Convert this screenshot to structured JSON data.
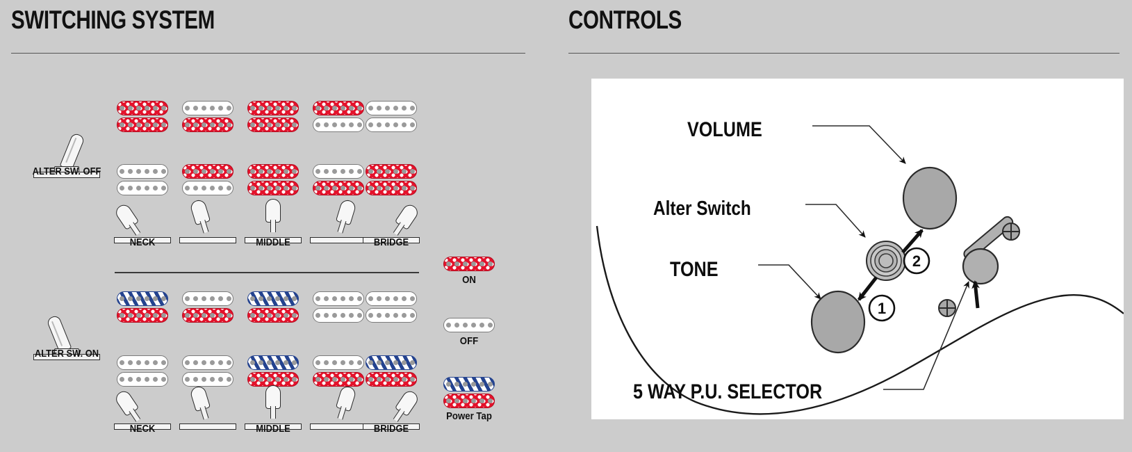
{
  "page": {
    "background_color": "#cccccc",
    "accent_on_color": "#e4122b",
    "accent_tap_color": "#24438f",
    "knob_color": "#a8a8a8"
  },
  "switching": {
    "title": "SWITCHING SYSTEM",
    "groups": [
      {
        "switch_label": "ALTER SW. OFF",
        "switch_state": "off",
        "position_labels": [
          "NECK",
          "",
          "MIDDLE",
          "",
          "BRIDGE"
        ],
        "rows": [
          [
            "on_on",
            "off_on",
            "on_on",
            "on_off",
            "off_off"
          ],
          [
            "off_off",
            "on_off",
            "on_on",
            "off_on",
            "on_on"
          ]
        ]
      },
      {
        "switch_label": "ALTER SW. ON",
        "switch_state": "on",
        "position_labels": [
          "NECK",
          "",
          "MIDDLE",
          "",
          "BRIDGE"
        ],
        "rows": [
          [
            "tap_on",
            "off_on",
            "tap_on",
            "off_off",
            "off_off"
          ],
          [
            "off_off",
            "off_off",
            "tap_on",
            "off_on",
            "tap_on"
          ]
        ]
      }
    ],
    "legend": [
      {
        "label": "ON",
        "kind": "on"
      },
      {
        "label": "OFF",
        "kind": "off"
      },
      {
        "label": "Power Tap",
        "kind": "tap"
      }
    ]
  },
  "controls": {
    "title": "CONTROLS",
    "labels": [
      {
        "text": "VOLUME"
      },
      {
        "text": "Alter Switch"
      },
      {
        "text": "TONE"
      },
      {
        "text": "5 WAY P.U. SELECTOR"
      }
    ],
    "markers": [
      {
        "text": "1"
      },
      {
        "text": "2"
      }
    ]
  }
}
